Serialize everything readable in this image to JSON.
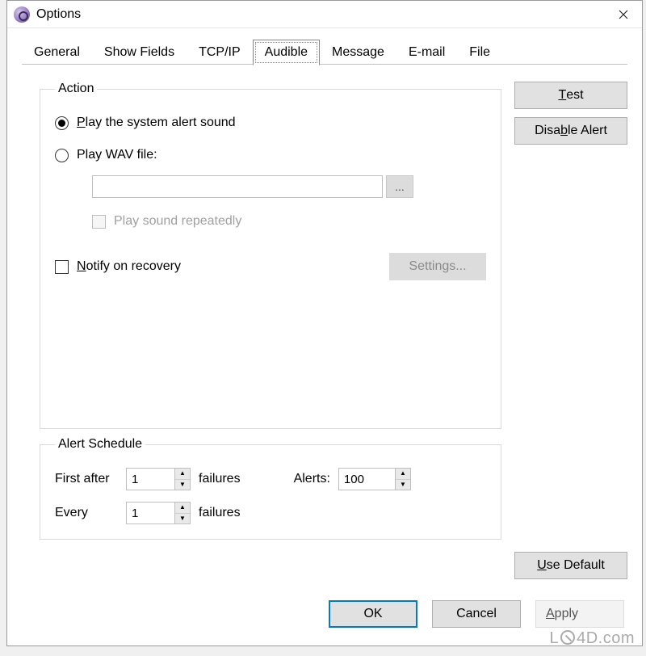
{
  "window": {
    "title": "Options"
  },
  "tabs": {
    "general": "General",
    "show_fields": "Show Fields",
    "tcpip": "TCP/IP",
    "audible": "Audible",
    "message": "Message",
    "email": "E-mail",
    "file": "File",
    "active": "audible"
  },
  "action": {
    "legend": "Action",
    "play_system_pre": "P",
    "play_system_rest": "lay the system alert sound",
    "play_wav": "Play WAV file:",
    "wav_value": "",
    "browse_label": "...",
    "repeat_label": "Play sound repeatedly",
    "notify_pre": "N",
    "notify_rest": "otify on recovery",
    "settings_label": "Settings..."
  },
  "schedule": {
    "legend": "Alert Schedule",
    "first_after_pre": "F",
    "first_after_rest": "irst after",
    "first_after_value": "1",
    "failures": "failures",
    "every_pre": "E",
    "every_rest": "very",
    "every_value": "1",
    "alerts_label": "Alerts:",
    "alerts_value": "100"
  },
  "buttons": {
    "test_pre": "T",
    "test_rest": "est",
    "disable_pre": "b",
    "disable_before": "Disa",
    "disable_after": "le Alert",
    "use_default_pre": "U",
    "use_default_rest": "se Default",
    "ok": "OK",
    "cancel": "Cancel",
    "apply_pre": "A",
    "apply_rest": "pply"
  },
  "watermark": {
    "prefix": "L",
    "suffix": "4D.com"
  }
}
